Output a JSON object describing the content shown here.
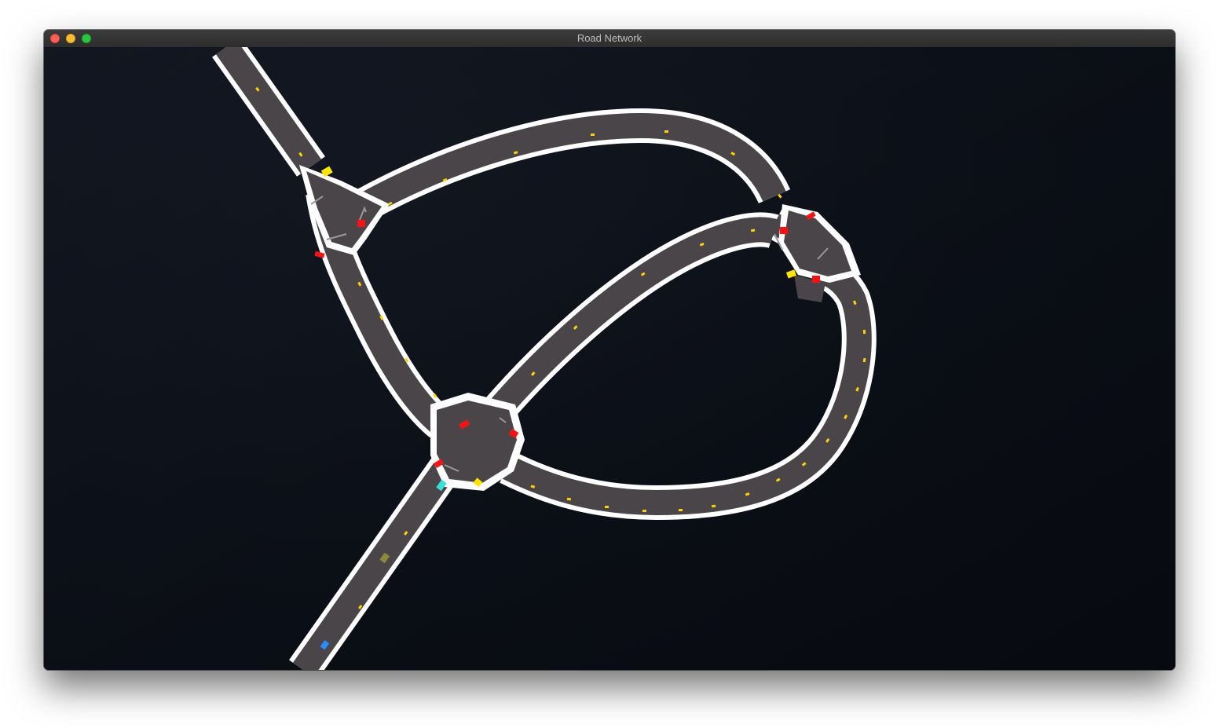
{
  "window": {
    "title": "Road Network",
    "buttons": [
      "close",
      "minimize",
      "zoom"
    ]
  },
  "scene": {
    "background_color": "#0b0f17",
    "road_color": "#4a4549",
    "curb_color": "#ffffff",
    "lane_mark_color": "#ffd200",
    "traffic_light_colors": {
      "red": "#ff1010",
      "yellow": "#ffe600"
    },
    "vehicle_colors": [
      "#35e0d8",
      "#8a8a3a",
      "#2a8cff"
    ]
  }
}
